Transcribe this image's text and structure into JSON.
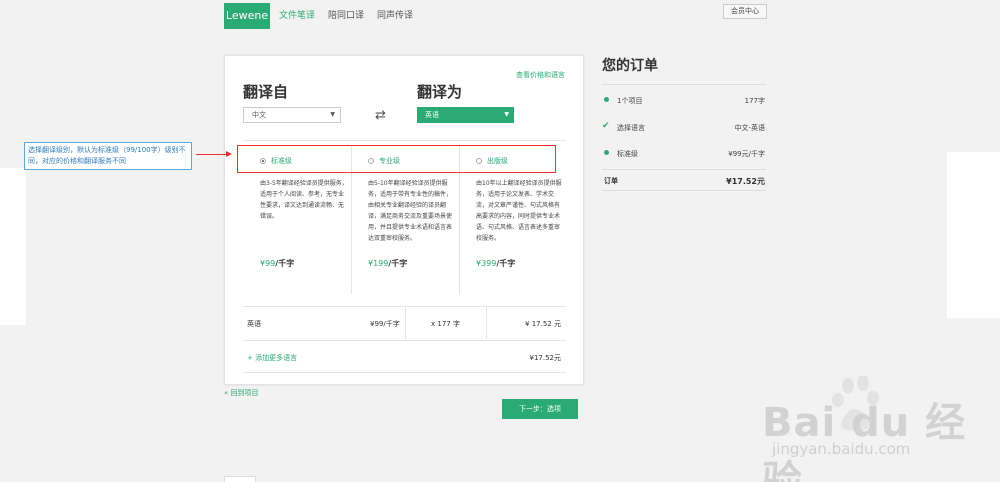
{
  "nav": {
    "logo": "Lewene",
    "links": [
      "文件笔译",
      "陪同口译",
      "同声传译"
    ],
    "member": "会员中心"
  },
  "card": {
    "price_link": "查看价格和语言",
    "from_title": "翻译自",
    "to_title": "翻译为",
    "from_value": "中文",
    "to_value": "英语",
    "swap_icon": "⇄",
    "levels": [
      {
        "label": "标准级",
        "checked": true,
        "desc": "由3-5年翻译经验译员提供服务，适用于个人阅读、参考，无专业性要求，译文达到通读流畅、无错误。",
        "price_num": "99",
        "price_unit": "/千字"
      },
      {
        "label": "专业级",
        "checked": false,
        "desc": "由5-10年翻译经验译员提供服务，适用于带有专业性的稿件，由相关专业翻译经验的译员翻译，满足商务交流及重要场景使用，并且提供专业术语和语言表达双重审校服务。",
        "price_num": "199",
        "price_unit": "/千字"
      },
      {
        "label": "出版级",
        "checked": false,
        "desc": "由10年以上翻译经验译员提供服务，适用于论文发表、学术交流，对文章严谨性、句式风格有高要求的内容，同时提供专业术语、句式风格、语言表述多重审校服务。",
        "price_num": "399",
        "price_unit": "/千字"
      }
    ],
    "row": {
      "lang": "英语",
      "unit_price": "¥99/千字",
      "count": "x 177 字",
      "subtotal": "¥ 17.52 元"
    },
    "add_lang": "+ 添加更多语言",
    "add_total": "¥17.52元",
    "currency": "¥"
  },
  "back_link": "« 回到项目",
  "next_button": "下一步：选项",
  "order": {
    "title": "您的订单",
    "items": [
      {
        "label": "1个项目",
        "value": "177字",
        "icon": "bullet"
      },
      {
        "label": "选择语言",
        "value": "中文-英语",
        "icon": "check"
      },
      {
        "label": "标准级",
        "value": "¥99元/千字",
        "icon": "bullet"
      }
    ],
    "total_label": "订单",
    "total_value": "¥17.52元"
  },
  "annotation": {
    "text": "选择翻译级别，默认为标准级（99/100字）级别不同，对应的价格和翻译服务不同"
  },
  "watermark": {
    "brand": "Bai du 经验",
    "url": "jingyan.baidu.com"
  },
  "colors": {
    "accent": "#2aab73",
    "annotation_red": "#e33333",
    "annotation_blue": "#2f7cc3"
  }
}
